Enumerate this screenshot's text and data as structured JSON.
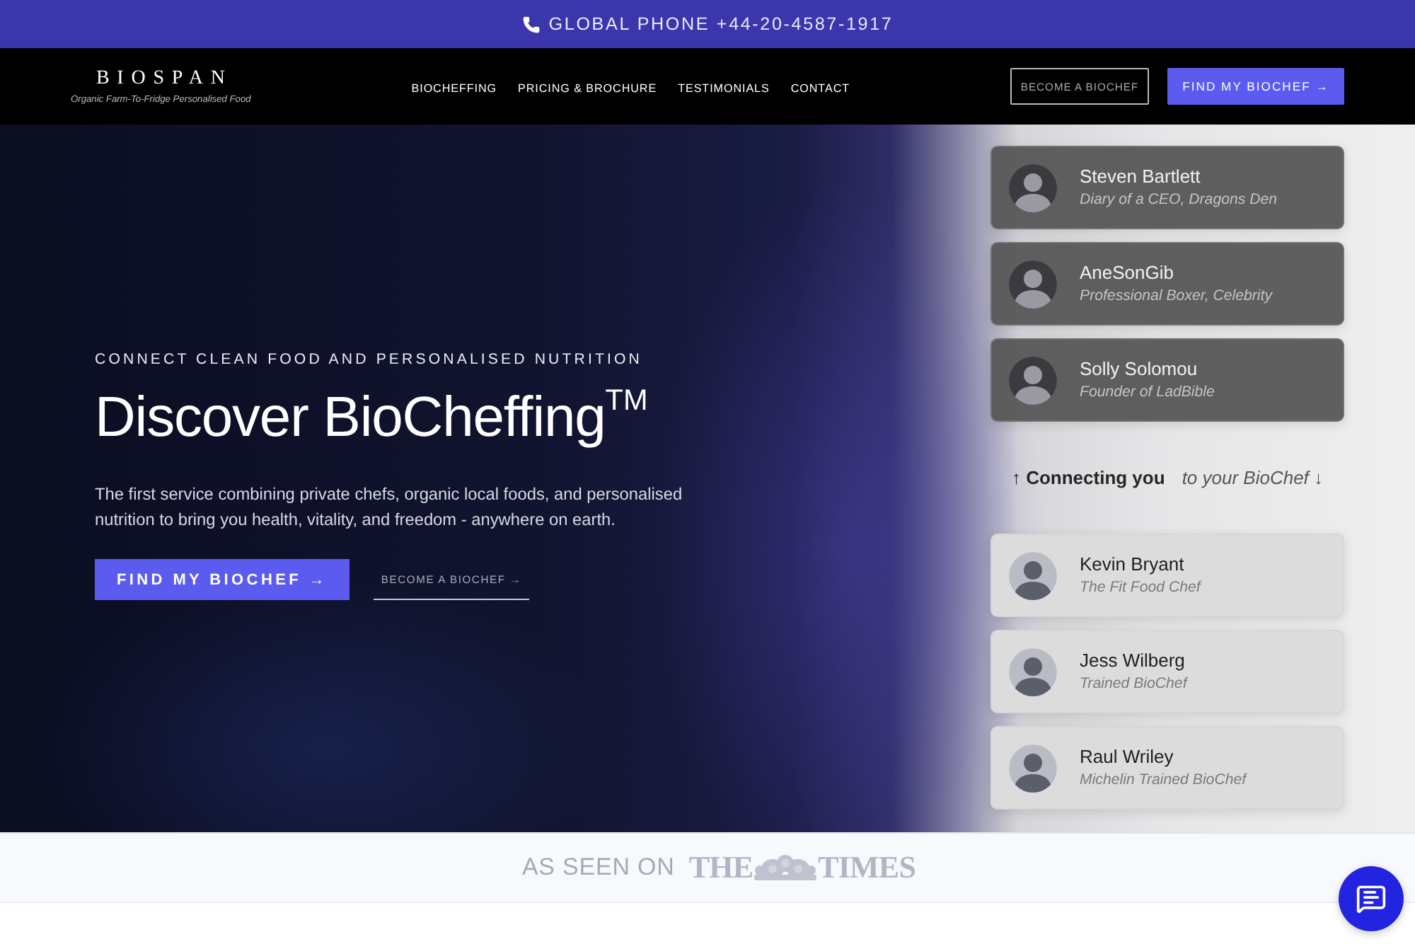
{
  "top_bar": {
    "phone": "GLOBAL PHONE +44-20-4587-1917"
  },
  "nav": {
    "logo": "BIOSPAN",
    "tagline": "Organic Farm-To-Fridge Personalised Food",
    "links": [
      "BIOCHEFFING",
      "PRICING & BROCHURE",
      "TESTIMONIALS",
      "CONTACT"
    ],
    "buttons": [
      {
        "label": "BECOME A BIOCHEF",
        "kind": "outline"
      },
      {
        "label": "FIND MY BIOCHEF →",
        "kind": "filled"
      }
    ]
  },
  "hero": {
    "eyebrow": "CONNECT CLEAN FOOD AND PERSONALISED NUTRITION",
    "title": "Discover BioCheffing$^{TM}$",
    "text": "The first service combining private chefs, organic local foods, and personalised nutrition to bring you health, vitality, and freedom - anywhere on earth.",
    "buttons": [
      {
        "label": "FIND MY BIOCHEF →",
        "kind": "filled"
      },
      {
        "label": "BECOME A BIOCHEF →",
        "kind": "underline"
      }
    ]
  },
  "endorsers": [
    {
      "name": "Steven Bartlett",
      "role": "Diary of a CEO, Dragons Den"
    },
    {
      "name": "AneSonGib",
      "role": "Professional Boxer, Celebrity"
    },
    {
      "name": "Solly Solomou",
      "role": "Founder of LadBible"
    }
  ],
  "connector": {
    "lead": "↑ Connecting you",
    "tail": "to your BioChef ↓"
  },
  "chefs": [
    {
      "name": "Kevin Bryant",
      "role": "The Fit Food Chef"
    },
    {
      "name": "Jess Wilberg",
      "role": "Trained BioChef"
    },
    {
      "name": "Raul Wriley",
      "role": "Michelin Trained BioChef"
    }
  ],
  "press": {
    "label": "AS SEEN ON",
    "logo_left": "THE",
    "logo_right": "TIMES"
  }
}
